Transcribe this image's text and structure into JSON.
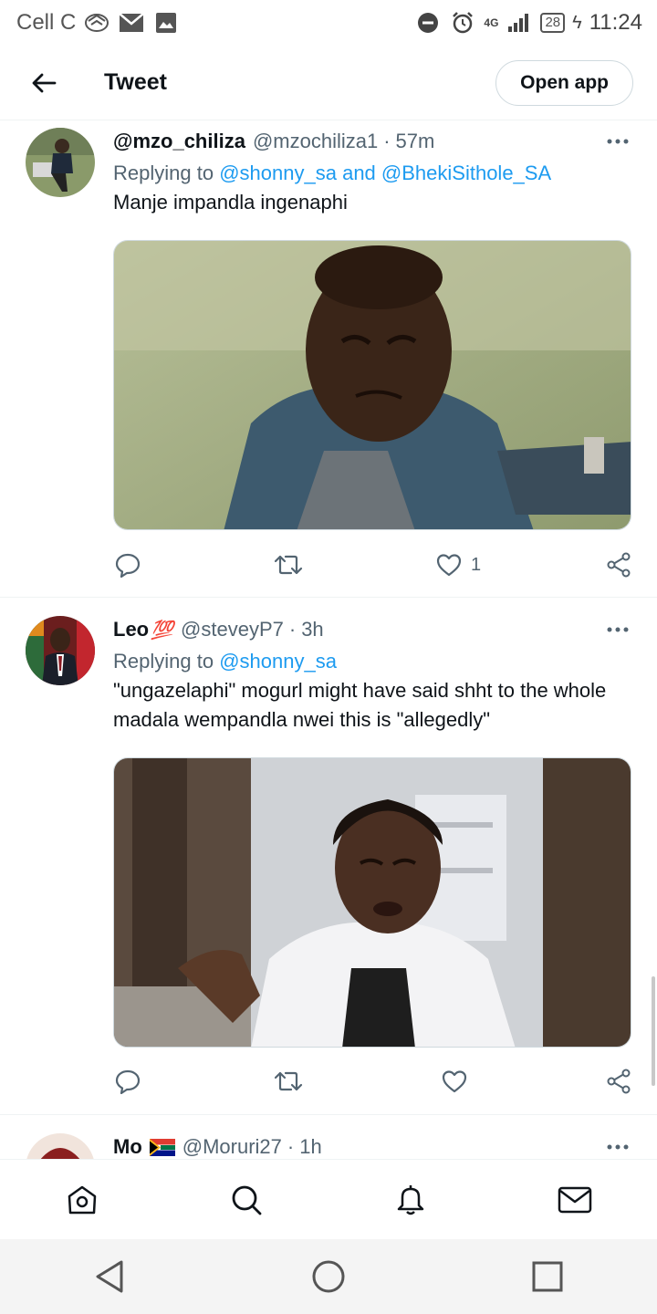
{
  "status_bar": {
    "carrier": "Cell C",
    "network": "4G",
    "battery": "28",
    "time": "11:24"
  },
  "header": {
    "title": "Tweet",
    "open_app_label": "Open app"
  },
  "tweets": [
    {
      "name": "@mzo_chiliza",
      "handle": "@mzochiliza1",
      "time": "57m",
      "replying_prefix": "Replying to",
      "reply_mentions": [
        "@shonny_sa",
        "@BhekiSithole_SA"
      ],
      "reply_joiner": "and",
      "text": "Manje impandla ingenaphi",
      "like_count": "1"
    },
    {
      "name": "Leo",
      "name_emoji": "💯",
      "handle": "@steveyP7",
      "time": "3h",
      "replying_prefix": "Replying to",
      "reply_mentions": [
        "@shonny_sa"
      ],
      "text": "\"ungazelaphi\" mogurl might have said shht to the whole madala wempandla nwei this is \"allegedly\"",
      "like_count": ""
    },
    {
      "name": "Mo",
      "handle": "@Moruri27",
      "time": "1h"
    }
  ],
  "icons": {
    "back": "arrow-left-icon",
    "more": "more-horizontal-icon",
    "reply": "reply-icon",
    "retweet": "retweet-icon",
    "like": "heart-icon",
    "share": "share-icon",
    "home": "home-icon",
    "search": "search-icon",
    "notifications": "bell-icon",
    "messages": "mail-icon"
  },
  "colors": {
    "accent": "#1d9bf0",
    "text": "#0f1419",
    "secondary": "#536471"
  }
}
